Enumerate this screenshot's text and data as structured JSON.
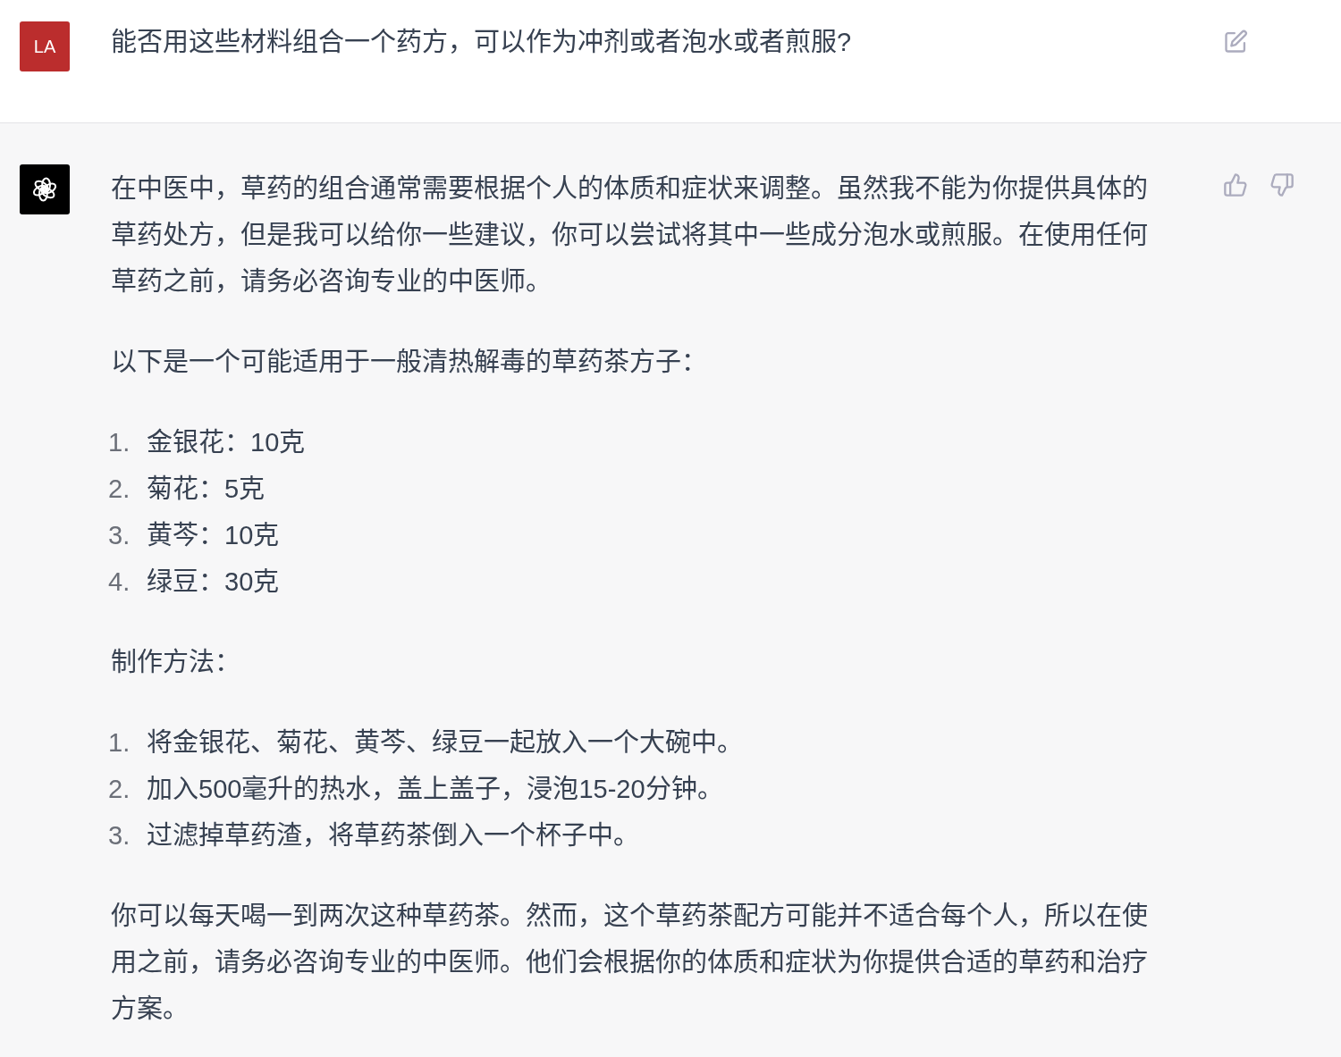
{
  "user_message": {
    "avatar": "LA",
    "text": "能否用这些材料组合一个药方，可以作为冲剂或者泡水或者煎服?"
  },
  "assistant_message": {
    "blocks": [
      {
        "kind": "paragraph",
        "text": "在中医中，草药的组合通常需要根据个人的体质和症状来调整。虽然我不能为你提供具体的草药处方，但是我可以给你一些建议，你可以尝试将其中一些成分泡水或煎服。在使用任何草药之前，请务必咨询专业的中医师。"
      },
      {
        "kind": "paragraph",
        "text": "以下是一个可能适用于一般清热解毒的草药茶方子："
      },
      {
        "kind": "list",
        "items": [
          {
            "marker": "1.",
            "text": "金银花：10克"
          },
          {
            "marker": "2.",
            "text": "菊花：5克"
          },
          {
            "marker": "3.",
            "text": "黄芩：10克"
          },
          {
            "marker": "4.",
            "text": "绿豆：30克"
          }
        ]
      },
      {
        "kind": "paragraph",
        "text": "制作方法："
      },
      {
        "kind": "list",
        "items": [
          {
            "marker": "1.",
            "text": "将金银花、菊花、黄芩、绿豆一起放入一个大碗中。"
          },
          {
            "marker": "2.",
            "text": "加入500毫升的热水，盖上盖子，浸泡15-20分钟。"
          },
          {
            "marker": "3.",
            "text": "过滤掉草药渣，将草药茶倒入一个杯子中。"
          }
        ]
      },
      {
        "kind": "paragraph",
        "text": "你可以每天喝一到两次这种草药茶。然而，这个草药茶配方可能并不适合每个人，所以在使用之前，请务必咨询专业的中医师。他们会根据你的体质和症状为你提供合适的草药和治疗方案。"
      }
    ]
  }
}
